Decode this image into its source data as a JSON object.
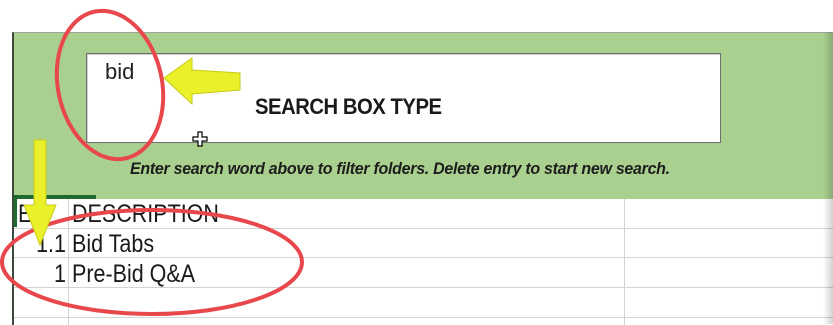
{
  "search": {
    "value": "bid",
    "annotation_label": "SEARCH BOX TYPE",
    "hint": "Enter search word above to filter folders.  Delete entry to start new search."
  },
  "table": {
    "columns": [
      "EX",
      "DESCRIPTION"
    ],
    "header_visible_col1": "EX",
    "rows": [
      {
        "ex": "1.1",
        "description": "Bid Tabs"
      },
      {
        "ex": "1",
        "description": "Pre-Bid Q&A"
      }
    ]
  },
  "colors": {
    "band": "#a9d08e",
    "annotation_red": "#e8474b",
    "annotation_yellow": "#eaf12a"
  },
  "icons": [
    "move-cursor-icon",
    "yellow-arrow-left",
    "yellow-arrow-down"
  ]
}
